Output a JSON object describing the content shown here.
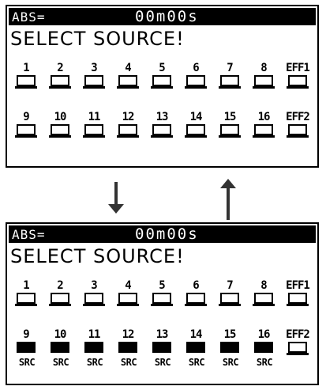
{
  "screen_top": {
    "abs_label": "ABS=",
    "time": "00m00s",
    "prompt": "SELECT SOURCE!",
    "row1": [
      {
        "label": "1",
        "on": false
      },
      {
        "label": "2",
        "on": false
      },
      {
        "label": "3",
        "on": false
      },
      {
        "label": "4",
        "on": false
      },
      {
        "label": "5",
        "on": false
      },
      {
        "label": "6",
        "on": false
      },
      {
        "label": "7",
        "on": false
      },
      {
        "label": "8",
        "on": false
      },
      {
        "label": "EFF1",
        "on": false
      }
    ],
    "row2": [
      {
        "label": "9",
        "on": false
      },
      {
        "label": "10",
        "on": false
      },
      {
        "label": "11",
        "on": false
      },
      {
        "label": "12",
        "on": false
      },
      {
        "label": "13",
        "on": false
      },
      {
        "label": "14",
        "on": false
      },
      {
        "label": "15",
        "on": false
      },
      {
        "label": "16",
        "on": false
      },
      {
        "label": "EFF2",
        "on": false
      }
    ]
  },
  "screen_bottom": {
    "abs_label": "ABS=",
    "time": "00m00s",
    "prompt": "SELECT SOURCE!",
    "row1": [
      {
        "label": "1",
        "on": false
      },
      {
        "label": "2",
        "on": false
      },
      {
        "label": "3",
        "on": false
      },
      {
        "label": "4",
        "on": false
      },
      {
        "label": "5",
        "on": false
      },
      {
        "label": "6",
        "on": false
      },
      {
        "label": "7",
        "on": false
      },
      {
        "label": "8",
        "on": false
      },
      {
        "label": "EFF1",
        "on": false
      }
    ],
    "row2": [
      {
        "label": "9",
        "on": true,
        "src": "SRC"
      },
      {
        "label": "10",
        "on": true,
        "src": "SRC"
      },
      {
        "label": "11",
        "on": true,
        "src": "SRC"
      },
      {
        "label": "12",
        "on": true,
        "src": "SRC"
      },
      {
        "label": "13",
        "on": true,
        "src": "SRC"
      },
      {
        "label": "14",
        "on": true,
        "src": "SRC"
      },
      {
        "label": "15",
        "on": true,
        "src": "SRC"
      },
      {
        "label": "16",
        "on": true,
        "src": "SRC"
      },
      {
        "label": "EFF2",
        "on": false
      }
    ]
  },
  "arrows": {
    "down_icon": "arrow-down-icon",
    "up_icon": "arrow-up-icon"
  }
}
